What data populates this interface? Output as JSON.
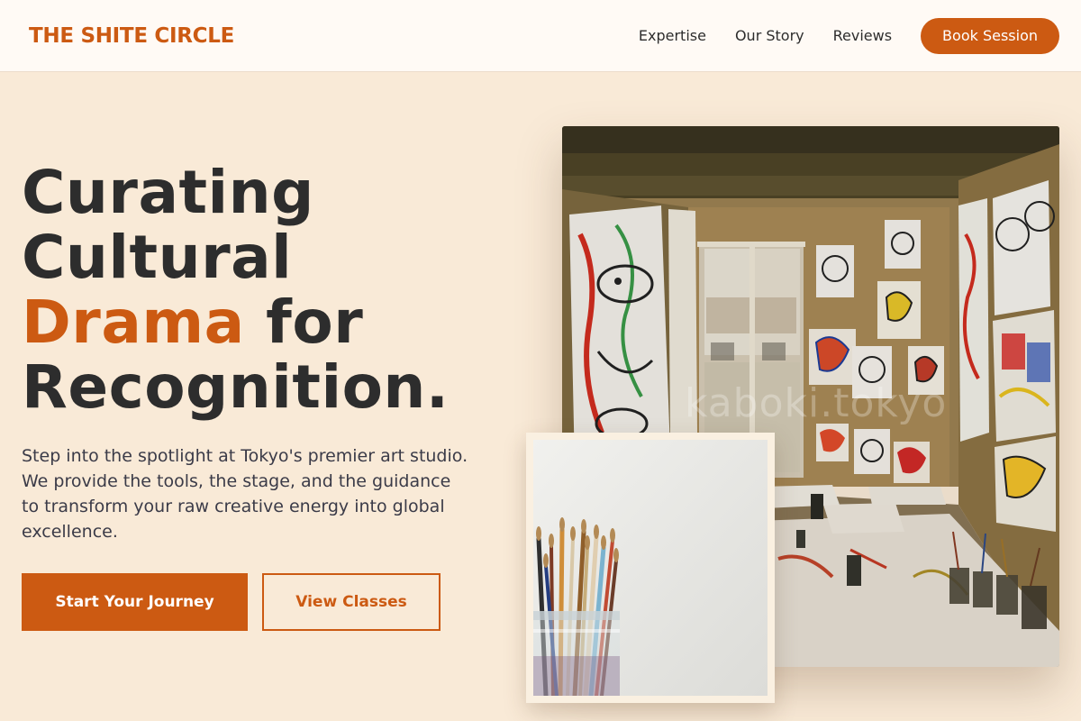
{
  "brand": {
    "name": "THE SHITE CIRCLE"
  },
  "nav": {
    "links": [
      "Expertise",
      "Our Story",
      "Reviews"
    ],
    "cta_label": "Book Session"
  },
  "hero": {
    "headline": {
      "line1": "Curating",
      "line2": "Cultural",
      "accent_word": "Drama",
      "line3_rest": " for",
      "line4": "Recognition."
    },
    "lead": "Step into the spotlight at Tokyo's premier art studio. We provide the tools, the stage, and the guidance to transform your raw creative energy into global excellence.",
    "primary_cta": "Start Your Journey",
    "secondary_cta": "View Classes"
  },
  "images": {
    "main_photo": {
      "watermark": "kaboki.tokyo"
    }
  },
  "colors": {
    "accent": "#cc5a12",
    "background": "#f9ead7",
    "nav_background": "#fffaf5",
    "text": "#2d2d2d"
  }
}
